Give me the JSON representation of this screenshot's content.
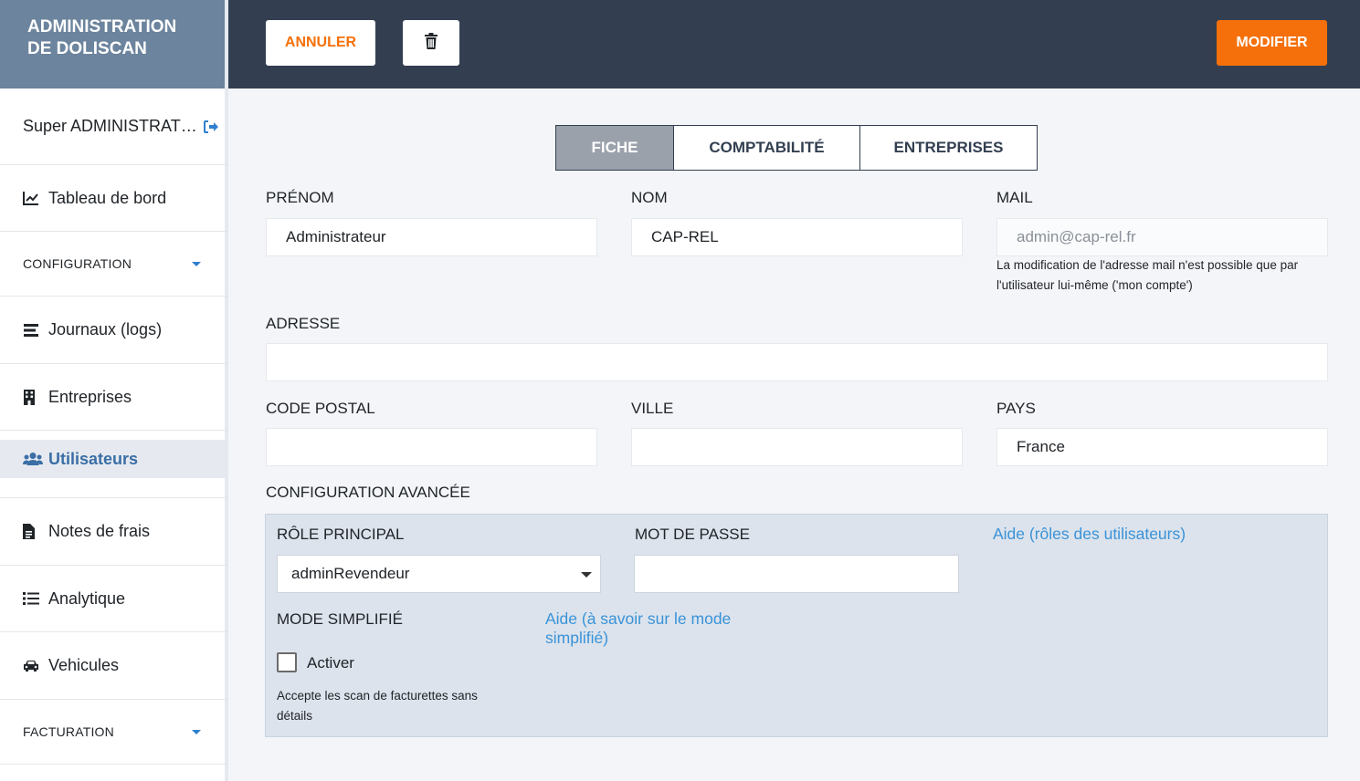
{
  "brand": {
    "line1": "ADMINISTRATION",
    "line2": "DE DOLISCAN"
  },
  "sidebar": {
    "user": "Super ADMINISTRAT…",
    "items": [
      {
        "label": "Tableau de bord",
        "icon": "chart-line-icon"
      },
      {
        "label": "CONFIGURATION",
        "icon": "chevron-down-icon"
      },
      {
        "label": "Journaux (logs)",
        "icon": "list-lines-icon"
      },
      {
        "label": "Entreprises",
        "icon": "building-icon"
      },
      {
        "label": "Utilisateurs",
        "icon": "users-icon"
      },
      {
        "label": "Notes de frais",
        "icon": "document-icon"
      },
      {
        "label": "Analytique",
        "icon": "list-icon"
      },
      {
        "label": "Vehicules",
        "icon": "car-icon"
      },
      {
        "label": "FACTURATION",
        "icon": "chevron-down-icon"
      }
    ],
    "active_item": "Utilisateurs"
  },
  "toolbar": {
    "cancel_label": "ANNULER",
    "modify_label": "MODIFIER"
  },
  "tabs": [
    {
      "label": "FICHE",
      "active": true
    },
    {
      "label": "COMPTABILITÉ",
      "active": false
    },
    {
      "label": "ENTREPRISES",
      "active": false
    }
  ],
  "form": {
    "prenom": {
      "label": "PRÉNOM",
      "value": "Administrateur"
    },
    "nom": {
      "label": "NOM",
      "value": "CAP-REL"
    },
    "mail": {
      "label": "MAIL",
      "value": "admin@cap-rel.fr",
      "help_line1": "La modification de l'adresse mail n'est possible que par",
      "help_line2": "l'utilisateur lui-même ('mon compte')"
    },
    "adresse": {
      "label": "ADRESSE",
      "value": ""
    },
    "code_postal": {
      "label": "CODE POSTAL",
      "value": ""
    },
    "ville": {
      "label": "VILLE",
      "value": ""
    },
    "pays": {
      "label": "PAYS",
      "value": "France"
    }
  },
  "advanced": {
    "title": "CONFIGURATION AVANCÉE",
    "role_label": "RÔLE PRINCIPAL",
    "role_value": "adminRevendeur",
    "password_label": "MOT DE PASSE",
    "password_value": "",
    "roles_help_link": "Aide (rôles des utilisateurs)",
    "mode_label": "MODE SIMPLIFIÉ",
    "mode_help_line1": "Aide (à savoir sur le mode",
    "mode_help_line2": "simplifié)",
    "activate_label": "Activer",
    "activate_checked": false,
    "activate_help_line1": "Accepte les scan de facturettes sans",
    "activate_help_line2": "détails"
  },
  "colors": {
    "accent": "#f5700a",
    "topbar": "#333f51",
    "brand_bg": "#6c849d",
    "link": "#3a93d8",
    "active_nav": "#3a6ea5"
  }
}
